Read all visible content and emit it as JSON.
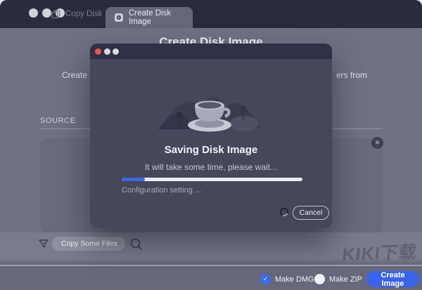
{
  "colors": {
    "accent_blue": "#3b63ea",
    "checkbox_blue": "#3a6cf3",
    "progress_fill": "#4066d8",
    "titlebar_bg": "#2a2c3d",
    "modal_bg": "#45475b",
    "page_bg": "#6f7184"
  },
  "titlebar": {
    "tabs": [
      {
        "label": "Copy Disk"
      },
      {
        "label": "Create Disk Image"
      }
    ]
  },
  "background_page": {
    "title": "Create Disk Image",
    "subtitle_left_fragment": "Create a d",
    "subtitle_right_fragment": "ers from",
    "source_label": "SOURCE",
    "filter_dropdown_value": "Copy Some Files"
  },
  "modal": {
    "title": "Saving Disk Image",
    "subtitle": "It will take some time, please wait...",
    "progress_percent": 13,
    "status_text": "Configuration setting ...",
    "cancel_label": "Cancel"
  },
  "footer": {
    "make_dmg_label": "Make DMG",
    "make_dmg_checked": true,
    "make_zip_label": "Make ZIP",
    "make_zip_checked": false,
    "create_button_label": "Create Image"
  },
  "watermark": "KIKI下载",
  "icons": {
    "check_glyph": "✓",
    "close_glyph": "✕"
  }
}
